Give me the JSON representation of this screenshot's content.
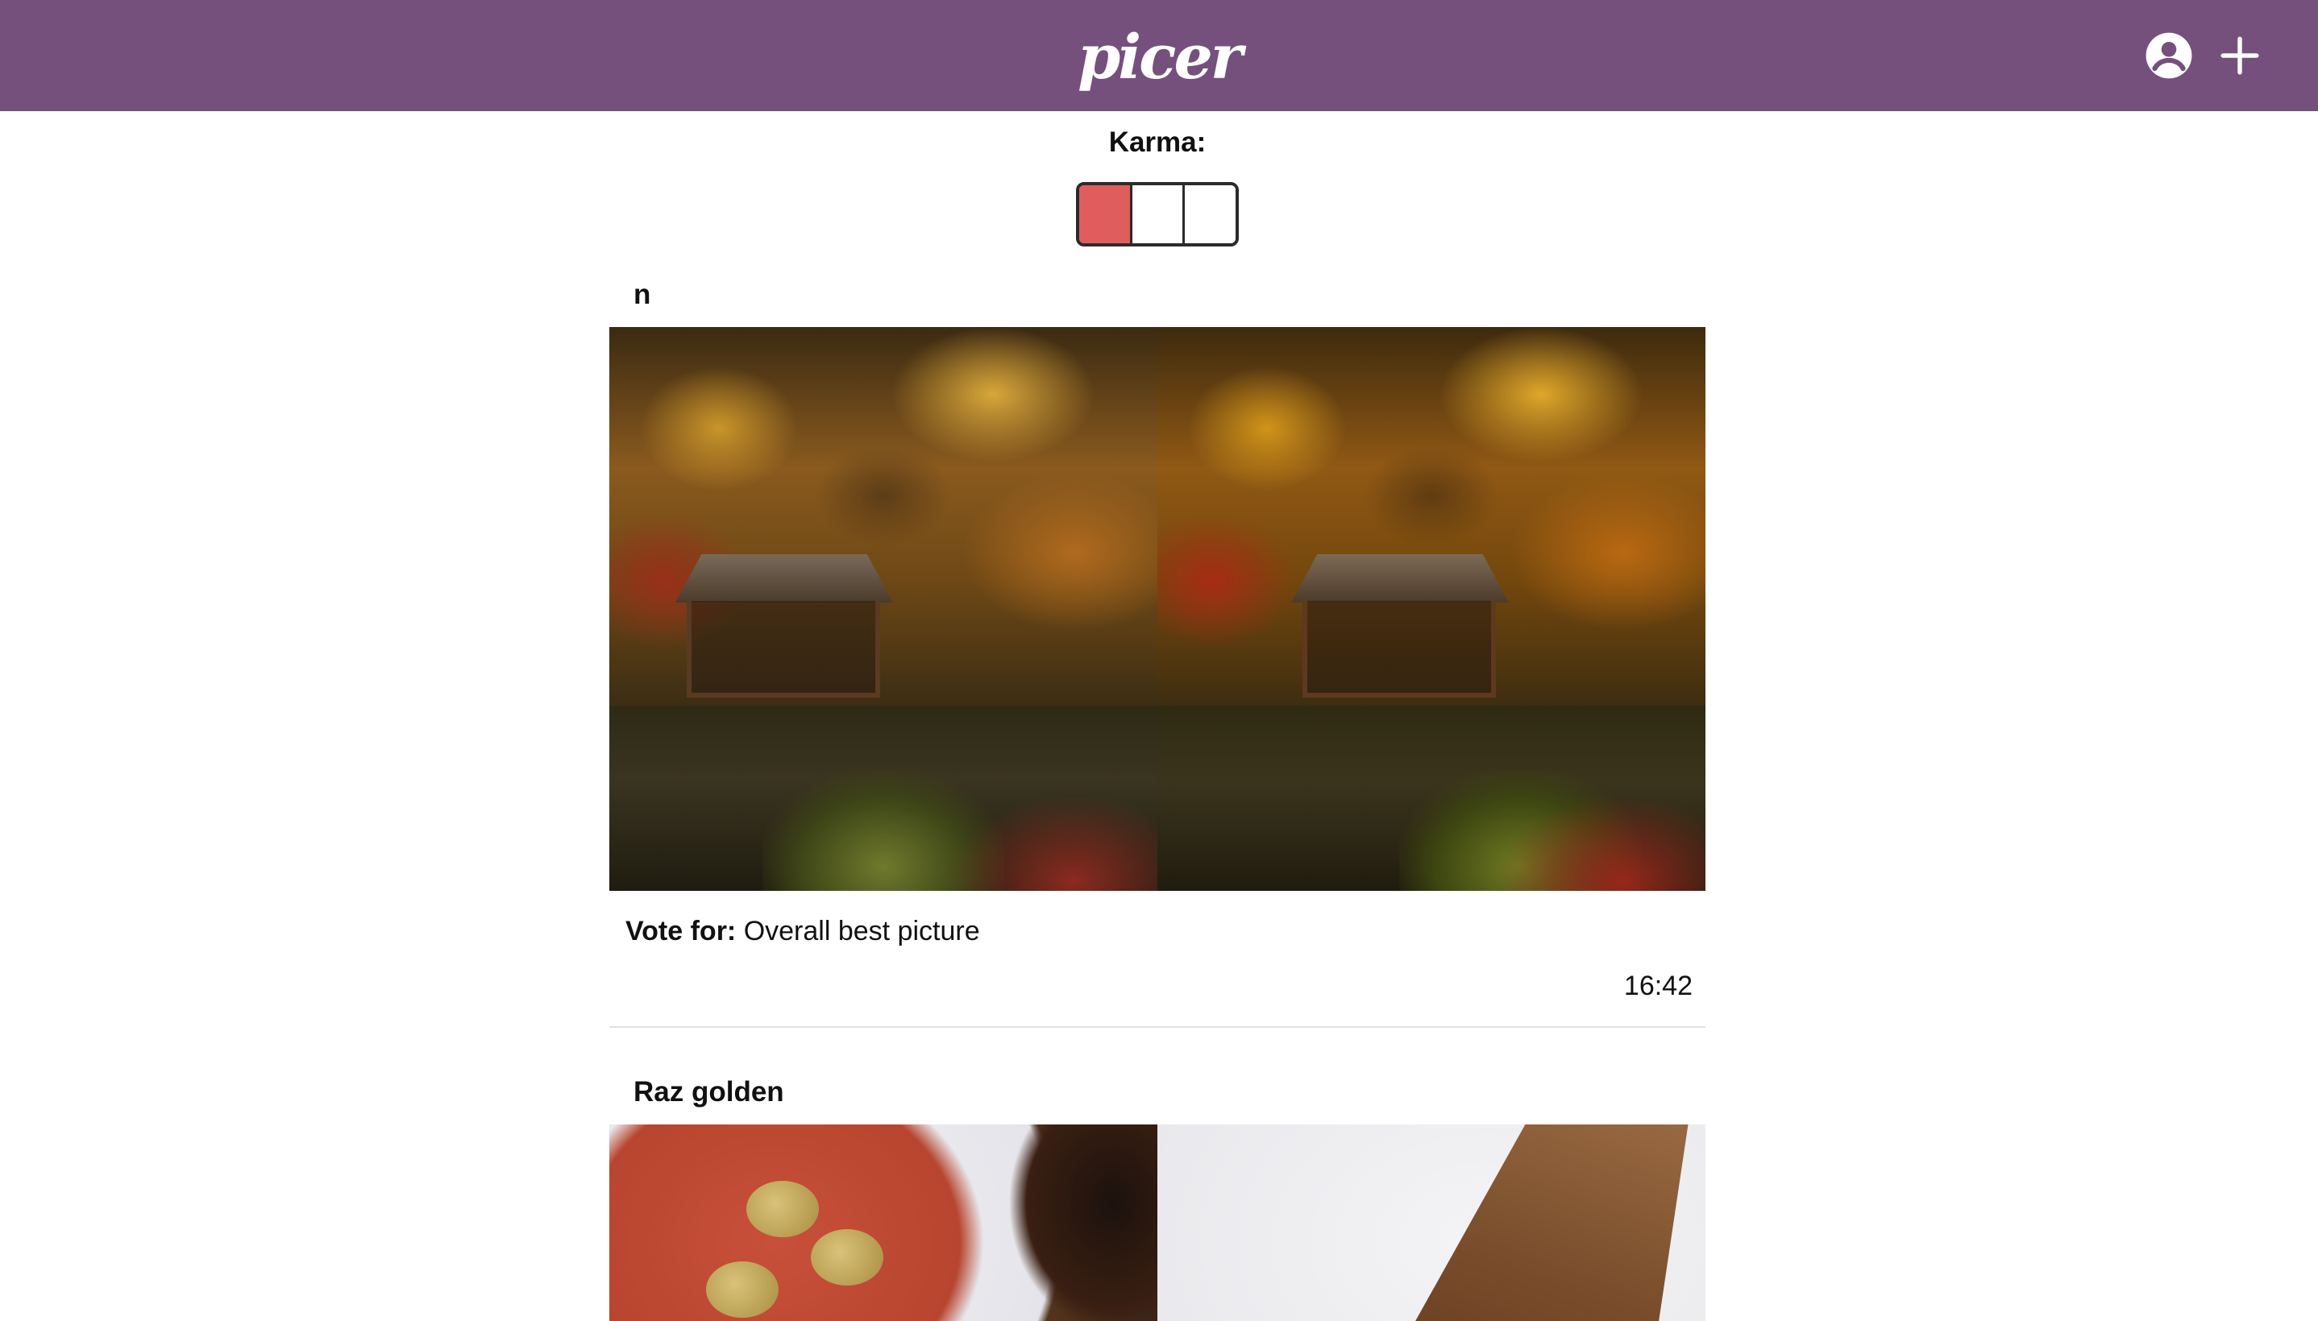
{
  "header": {
    "logo_text": "picer",
    "background_color": "#76507d",
    "icons": [
      "account-circle-icon",
      "plus-icon"
    ]
  },
  "karma": {
    "label": "Karma:",
    "filled_segments": 1,
    "total_segments": 3,
    "fill_color": "#e05d5d"
  },
  "posts": [
    {
      "author": "n",
      "vote_label": "Vote for:",
      "vote_topic": "Overall best picture",
      "time": "16:42"
    },
    {
      "author": "Raz golden"
    }
  ]
}
